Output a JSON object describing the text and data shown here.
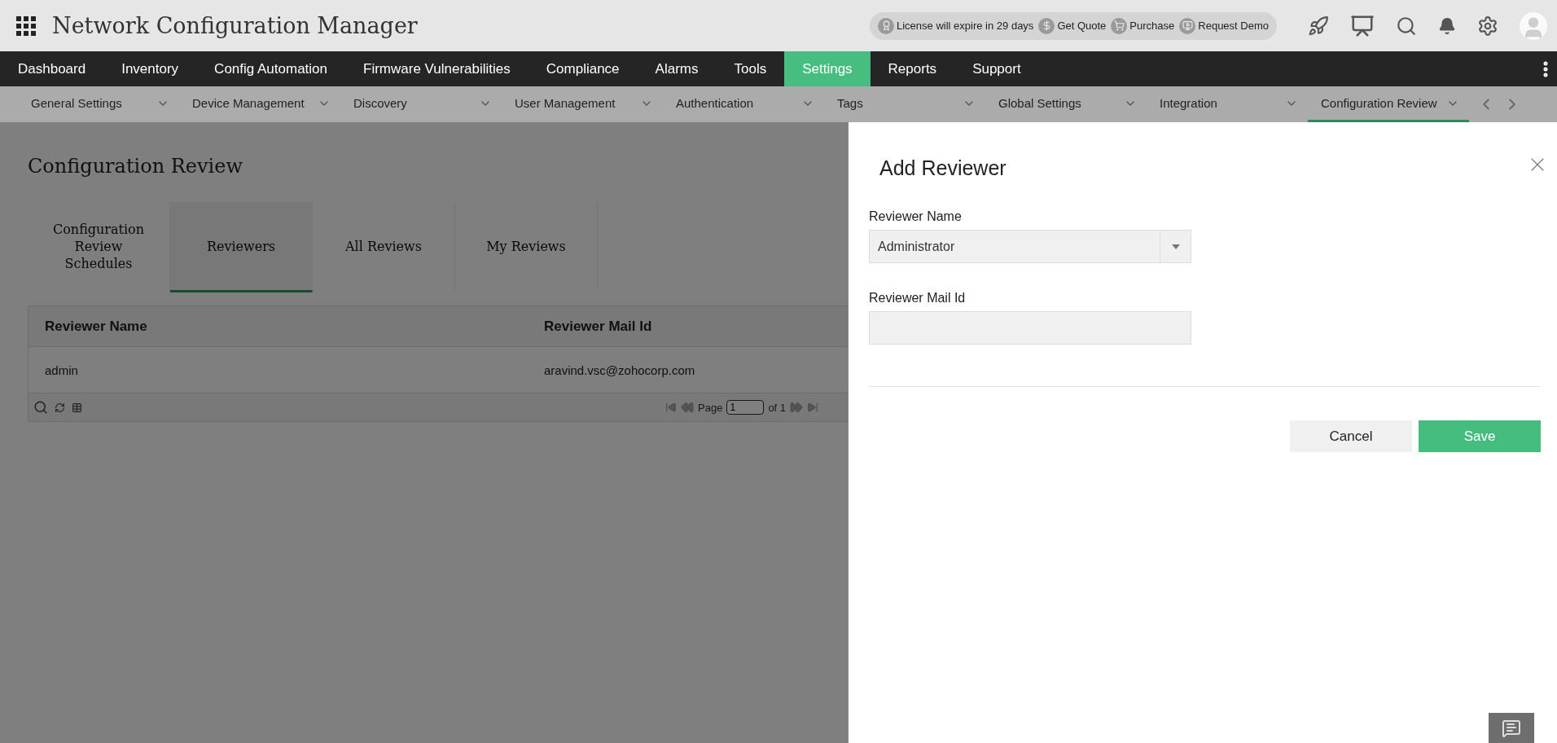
{
  "header": {
    "title": "Network Configuration Manager"
  },
  "license_bar": [
    {
      "kind": "license",
      "text": "License will expire in 29 days"
    },
    {
      "kind": "quote",
      "text": "Get Quote"
    },
    {
      "kind": "purchase",
      "text": "Purchase"
    },
    {
      "kind": "demo",
      "text": "Request Demo"
    }
  ],
  "nav": [
    {
      "label": "Dashboard",
      "selected": false
    },
    {
      "label": "Inventory",
      "selected": false
    },
    {
      "label": "Config Automation",
      "selected": false
    },
    {
      "label": "Firmware Vulnerabilities",
      "selected": false
    },
    {
      "label": "Compliance",
      "selected": false
    },
    {
      "label": "Alarms",
      "selected": false
    },
    {
      "label": "Tools",
      "selected": false
    },
    {
      "label": "Settings",
      "selected": true
    },
    {
      "label": "Reports",
      "selected": false
    },
    {
      "label": "Support",
      "selected": false
    }
  ],
  "subnav": [
    {
      "label": "General Settings",
      "selected": false
    },
    {
      "label": "Device Management",
      "selected": false
    },
    {
      "label": "Discovery",
      "selected": false
    },
    {
      "label": "User Management",
      "selected": false
    },
    {
      "label": "Authentication",
      "selected": false
    },
    {
      "label": "Tags",
      "selected": false
    },
    {
      "label": "Global Settings",
      "selected": false
    },
    {
      "label": "Integration",
      "selected": false
    },
    {
      "label": "Configuration Review",
      "selected": true
    }
  ],
  "page": {
    "title": "Configuration Review",
    "tabs": [
      {
        "label": "Configuration Review Schedules",
        "selected": false
      },
      {
        "label": "Reviewers",
        "selected": true
      },
      {
        "label": "All Reviews",
        "selected": false
      },
      {
        "label": "My Reviews",
        "selected": false
      }
    ],
    "table": {
      "columns": [
        "Reviewer Name",
        "Reviewer Mail Id"
      ],
      "rows": [
        [
          "admin",
          "aravind.vsc@zohocorp.com"
        ]
      ]
    },
    "pager": {
      "label": "Page",
      "page": "1",
      "of": "of 1"
    }
  },
  "drawer": {
    "title": "Add Reviewer",
    "fields": [
      {
        "kind": "select",
        "label": "Reviewer Name",
        "value": "Administrator"
      },
      {
        "kind": "text",
        "label": "Reviewer Mail Id"
      }
    ],
    "buttons": [
      {
        "kind": "secondary",
        "label": "Cancel"
      },
      {
        "kind": "primary",
        "label": "Save"
      }
    ]
  }
}
